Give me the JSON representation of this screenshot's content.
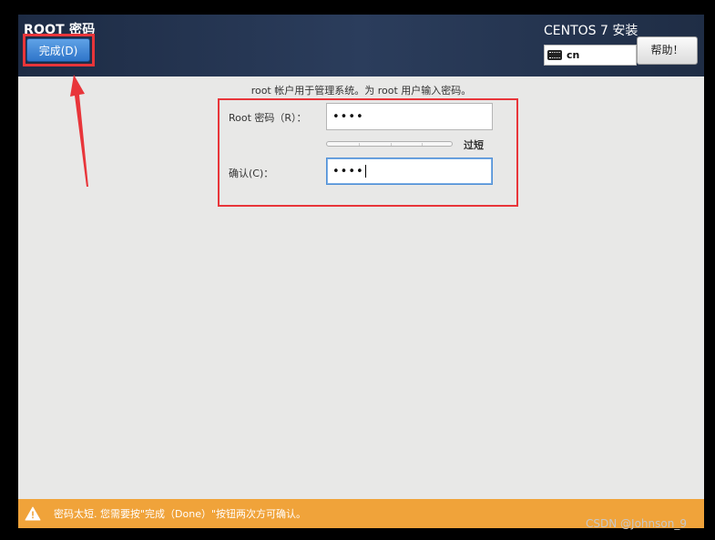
{
  "header": {
    "title": "ROOT 密码",
    "done_label": "完成(D)",
    "product": "CENTOS 7 安装",
    "keyboard_layout": "cn",
    "help_label": "帮助！"
  },
  "main": {
    "info_text": "root 帐户用于管理系统。为 root 用户输入密码。",
    "password_label": "Root 密码（R）：",
    "password_value": "••••",
    "strength_label": "过短",
    "confirm_label": "确认(C)：",
    "confirm_value": "••••"
  },
  "warning": {
    "text": "密码太短. 您需要按\"完成（Done）\"按钮两次方可确认。",
    "color": "#f0a33a"
  },
  "watermark": "CSDN @Johnson_9",
  "colors": {
    "annotation": "#e8353a",
    "header_bg": "#1d2b44",
    "done_button": "#2f75c9"
  }
}
